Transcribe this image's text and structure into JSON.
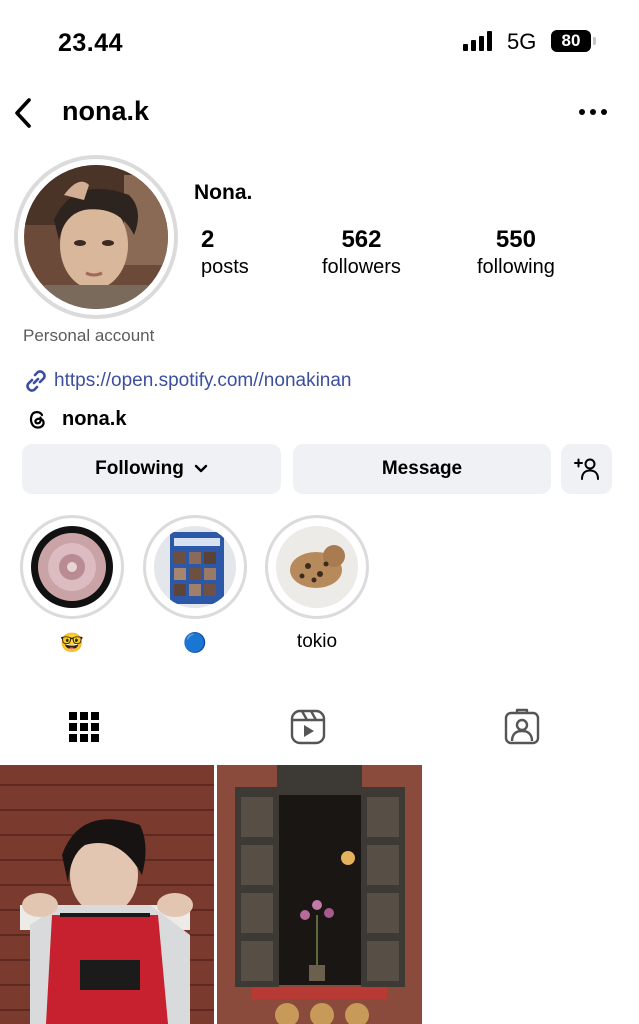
{
  "status_bar": {
    "time": "23.44",
    "network": "5G",
    "battery": "80"
  },
  "header": {
    "username": "nona.k",
    "back_icon": "chevron-left-icon",
    "more_icon": "more-horizontal-icon"
  },
  "profile": {
    "display_name": "Nona.",
    "stats": [
      {
        "value": "2",
        "label": "posts"
      },
      {
        "value": "562",
        "label": "followers"
      },
      {
        "value": "550",
        "label": "following"
      }
    ],
    "category": "Personal account",
    "link": "https://open.spotify.com//nonakinan",
    "threads_handle": "nona.k"
  },
  "actions": {
    "following": "Following",
    "message": "Message",
    "add_user_icon": "add-user-icon"
  },
  "highlights": [
    {
      "label": "🤓"
    },
    {
      "label": "🔵"
    },
    {
      "label": "tokio"
    }
  ],
  "tabs": [
    "grid-icon",
    "reels-icon",
    "tagged-icon"
  ],
  "colors": {
    "link": "#3b4f9e",
    "button_bg": "#eff1f4",
    "ring": "#dbdbdb"
  }
}
